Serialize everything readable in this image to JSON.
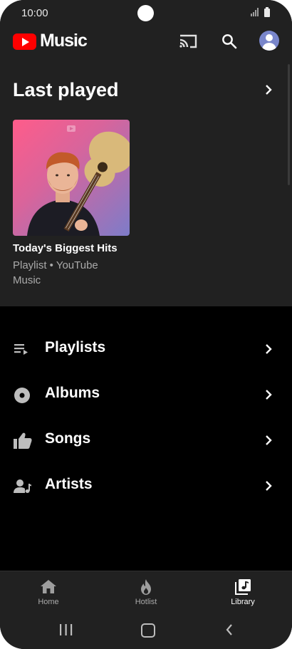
{
  "status_bar": {
    "time": "10:00"
  },
  "header": {
    "logo_text": "Music",
    "icons": [
      "cast-icon",
      "search-icon",
      "account-avatar"
    ]
  },
  "last_played": {
    "title": "Last played",
    "item": {
      "title": "Today's Biggest Hits",
      "subtitle": "Playlist • YouTube Music"
    }
  },
  "library": {
    "items": [
      {
        "label": "Playlists",
        "icon": "playlist-icon"
      },
      {
        "label": "Albums",
        "icon": "album-icon"
      },
      {
        "label": "Songs",
        "icon": "thumb-up-icon"
      },
      {
        "label": "Artists",
        "icon": "artist-icon"
      }
    ]
  },
  "bottom_nav": {
    "items": [
      {
        "label": "Home",
        "icon": "home-icon"
      },
      {
        "label": "Hotlist",
        "icon": "flame-icon"
      },
      {
        "label": "Library",
        "icon": "library-music-icon"
      }
    ],
    "active": "Library"
  },
  "colors": {
    "background": "#000000",
    "surface": "#212121",
    "brand_red": "#ff0000",
    "text_secondary": "#aaaaaa"
  }
}
